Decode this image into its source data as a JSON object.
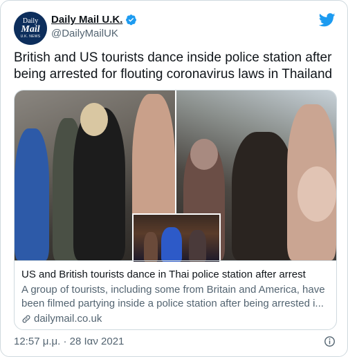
{
  "account": {
    "avatar_line1": "Daily",
    "avatar_line2": "Mail",
    "avatar_line3": "U.K. NEWS",
    "name": "Daily Mail U.K.",
    "handle": "@DailyMailUK",
    "verified": true
  },
  "tweet": {
    "text": "British and US tourists dance inside police station after being arrested for flouting coronavirus laws in Thailand"
  },
  "link_card": {
    "title": "US and British tourists dance in Thai police station after arrest",
    "description": "A group of tourists, including some from Britain and America, have been filmed partying inside a police station after being arrested i...",
    "domain": "dailymail.co.uk"
  },
  "timestamp": "12:57 μ.μ. · 28 Ιαν 2021",
  "colors": {
    "brand_blue": "#1d9bf0",
    "text_primary": "#0f1419",
    "text_secondary": "#536471",
    "border": "#cfd9de"
  },
  "icons": [
    "verified-badge-icon",
    "twitter-bird-icon",
    "link-icon",
    "info-icon"
  ]
}
